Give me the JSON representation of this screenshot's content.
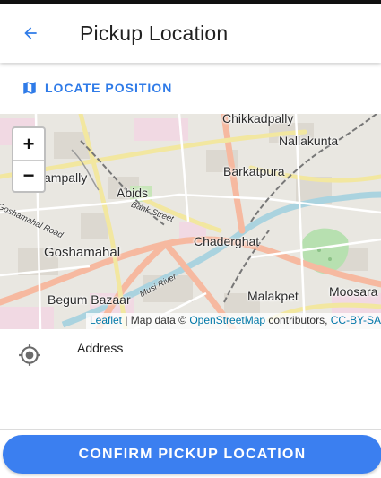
{
  "header": {
    "title": "Pickup Location",
    "back_icon": "arrow-left-icon"
  },
  "locate": {
    "label": "LOCATE POSITION",
    "icon": "map-icon"
  },
  "map": {
    "zoom_in": "+",
    "zoom_out": "−",
    "places": {
      "chikkadpally": "Chikkadpally",
      "nallakunta": "Nallakunta",
      "nampally": "ampally",
      "barkatpura": "Barkatpura",
      "abids": "Abids",
      "chaderghat": "Chaderghat",
      "goshamahal": "Goshamahal",
      "begum_bazaar": "Begum Bazaar",
      "malakpet": "Malakpet",
      "moosara": "Moosara"
    },
    "roads": {
      "bank_street": "Bank Street",
      "goshamahal_road": "Goshamahal Road",
      "musi_river": "Musi River"
    },
    "attribution": {
      "leaflet": "Leaflet",
      "sep1": " | Map data © ",
      "osm": "OpenStreetMap",
      "sep2": " contributors, ",
      "license": "CC-BY-SA"
    }
  },
  "address": {
    "label": "Address",
    "icon": "my-location-icon"
  },
  "confirm": {
    "label": "CONFIRM PICKUP LOCATION"
  },
  "colors": {
    "accent": "#2f7be8",
    "button": "#3b7ff0"
  }
}
